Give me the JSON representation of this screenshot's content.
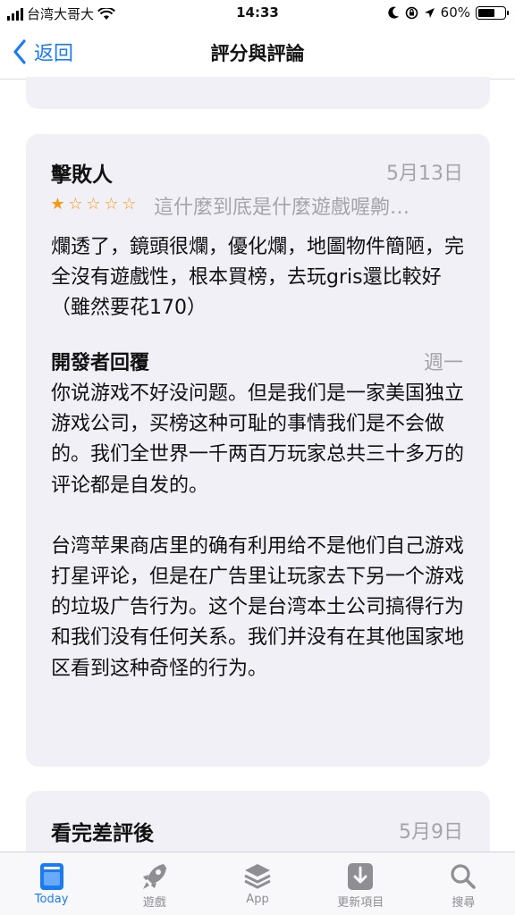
{
  "status": {
    "carrier": "台湾大哥大",
    "time": "14:33",
    "battery": "60%",
    "battery_level": 0.6
  },
  "nav": {
    "back_label": "返回",
    "title": "評分與評論"
  },
  "reviews": [
    {
      "title": "擊敗人",
      "date": "5月13日",
      "rating": 1,
      "subtitle": "這什麼到底是什麼遊戲喔齁…",
      "body": "爛透了，鏡頭很爛，優化爛，地圖物件簡陋，完全沒有遊戲性，根本買榜，去玩gris還比較好（雖然要花170）",
      "developer_response": {
        "label": "開發者回覆",
        "date": "週一",
        "paragraphs": [
          "你说游戏不好没问题。但是我们是一家美国独立游戏公司，买榜这种可耻的事情我们是不会做的。我们全世界一千两百万玩家总共三十多万的评论都是自发的。",
          "台湾苹果商店里的确有利用给不是他们自己游戏打星评论，但是在广告里让玩家去下另一个游戏的垃圾广告行为。这个是台湾本土公司搞得行为和我们没有任何关系。我们并没有在其他国家地区看到这种奇怪的行为。"
        ]
      }
    },
    {
      "title": "看完差評後",
      "date": "5月9日"
    }
  ],
  "tabs": [
    {
      "label": "Today",
      "icon": "today-icon",
      "active": true
    },
    {
      "label": "遊戲",
      "icon": "rocket-icon",
      "active": false
    },
    {
      "label": "App",
      "icon": "layers-icon",
      "active": false
    },
    {
      "label": "更新項目",
      "icon": "download-icon",
      "active": false
    },
    {
      "label": "搜尋",
      "icon": "search-icon",
      "active": false
    }
  ],
  "colors": {
    "accent": "#1a7cf5",
    "star": "#f39a12",
    "card_bg": "#f0f0f6",
    "muted": "#a4a4ab"
  }
}
